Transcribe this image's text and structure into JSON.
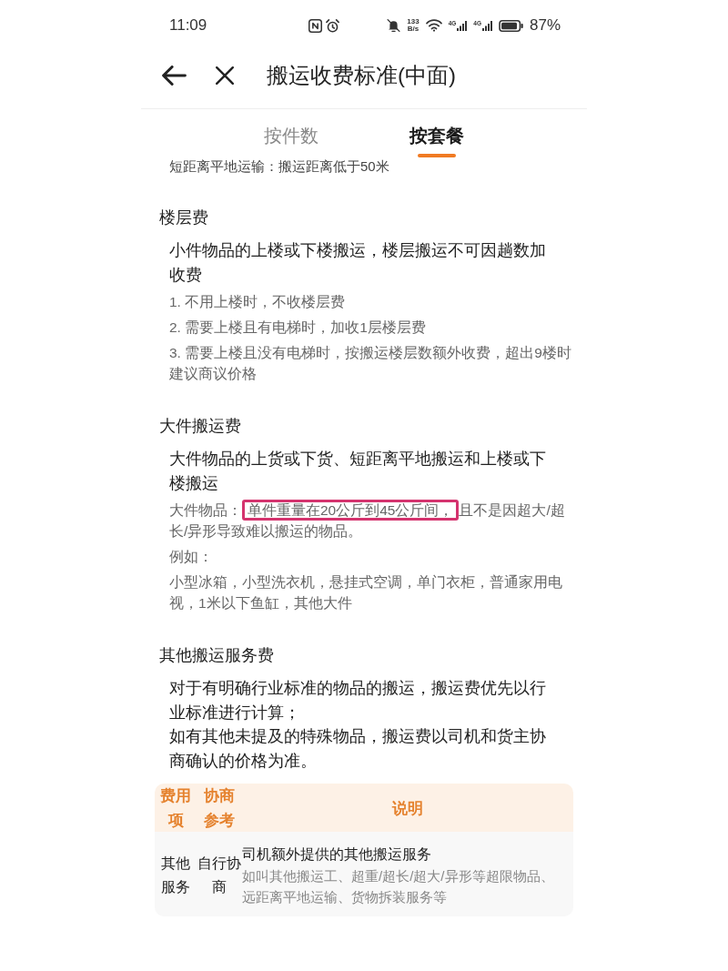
{
  "status_bar": {
    "time": "11:09",
    "net_speed": {
      "value": "133",
      "unit": "B/s"
    },
    "signals": [
      {
        "network": "4G"
      },
      {
        "network": "4G"
      }
    ],
    "battery": "87%"
  },
  "header": {
    "title": "搬运收费标准(中面)"
  },
  "tabs": [
    {
      "label": "按件数",
      "selected": false
    },
    {
      "label": "按套餐",
      "selected": true
    }
  ],
  "intro": "短距离平地运输：搬运距离低于50米",
  "sections": [
    {
      "title": "楼层费",
      "blocks": [
        {
          "kind": "lead",
          "text": "小件物品的上楼或下楼搬运，楼层搬运不可因趟数加收费"
        },
        {
          "kind": "detail",
          "text": "1. 不用上楼时，不收楼层费"
        },
        {
          "kind": "detail",
          "text": "2. 需要上楼且有电梯时，加收1层楼层费"
        },
        {
          "kind": "detail",
          "text": "3. 需要上楼且没有电梯时，按搬运楼层数额外收费，超出9楼时建议商议价格"
        }
      ]
    },
    {
      "title": "大件搬运费",
      "blocks": [
        {
          "kind": "lead",
          "text": "大件物品的上货或下货、短距离平地搬运和上楼或下楼搬运"
        },
        {
          "kind": "marked",
          "parts": [
            {
              "text": "大件物品：",
              "highlighted": false
            },
            {
              "text": "单件重量在20公斤到45公斤间，",
              "highlighted": true
            },
            {
              "text": "且不是因超大/超长/异形导致难以搬运的物品。",
              "highlighted": false
            }
          ]
        },
        {
          "kind": "detail",
          "text": "例如："
        },
        {
          "kind": "detail",
          "text": "小型冰箱，小型洗衣机，悬挂式空调，单门衣柜，普通家用电视，1米以下鱼缸，其他大件"
        }
      ]
    },
    {
      "title": "其他搬运服务费",
      "blocks": [
        {
          "kind": "lead",
          "text": "对于有明确行业标准的物品的搬运，搬运费优先以行业标准进行计算；"
        },
        {
          "kind": "lead",
          "text": "如有其他未提及的特殊物品，搬运费以司机和货主协商确认的价格为准。"
        }
      ]
    }
  ],
  "fee_table": {
    "columns": [
      "费用项",
      "协商参考",
      "说明"
    ],
    "rows": [
      {
        "item": "其他服务",
        "reference": "自行协商",
        "title": "司机额外提供的其他搬运服务",
        "description": "如叫其他搬运工、超重/超长/超大/异形等超限物品、远距离平地运输、货物拆装服务等"
      }
    ]
  }
}
